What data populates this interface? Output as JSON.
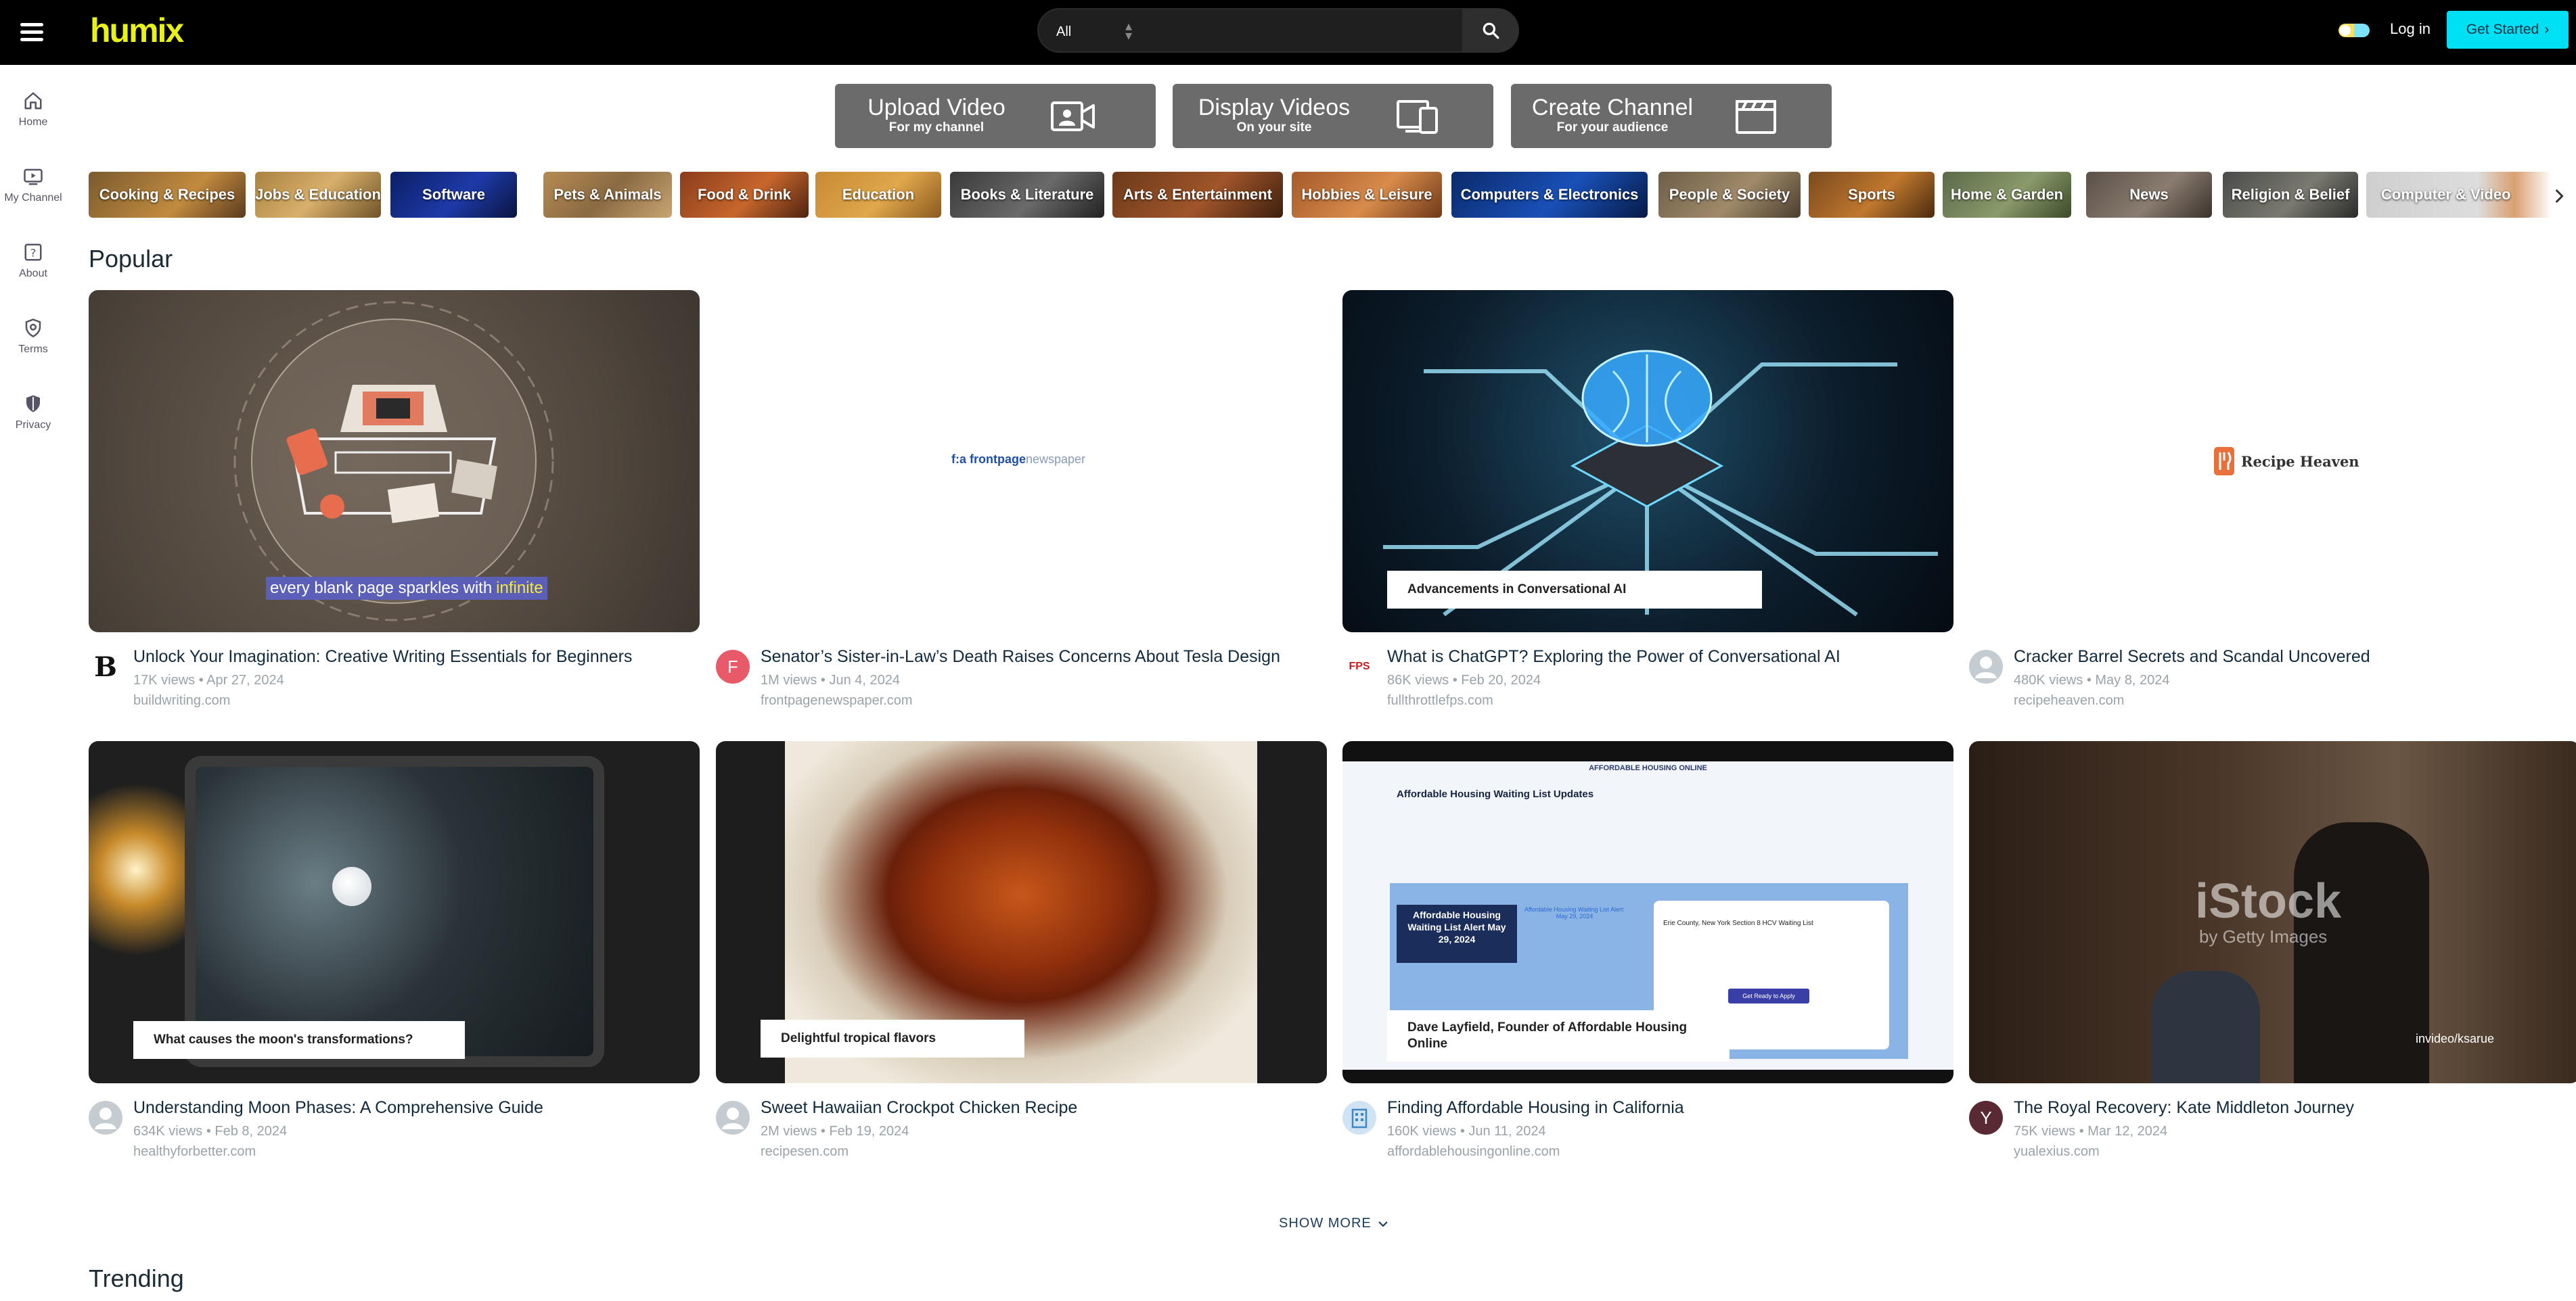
{
  "header": {
    "logo": "humix",
    "search_scope": "All",
    "search_placeholder": "",
    "login": "Log in",
    "get_started": "Get Started"
  },
  "sidebar": {
    "items": [
      {
        "label": "Home",
        "icon": "home-icon"
      },
      {
        "label": "My Channel",
        "icon": "channel-icon"
      },
      {
        "label": "About",
        "icon": "about-icon"
      },
      {
        "label": "Terms",
        "icon": "terms-icon"
      },
      {
        "label": "Privacy",
        "icon": "privacy-icon"
      }
    ]
  },
  "actions": [
    {
      "title": "Upload Video",
      "subtitle": "For my channel",
      "icon": "camera-icon"
    },
    {
      "title": "Display Videos",
      "subtitle": "On your site",
      "icon": "devices-icon"
    },
    {
      "title": "Create Channel",
      "subtitle": "For your audience",
      "icon": "clapperboard-icon"
    }
  ],
  "categories": [
    "Cooking & Recipes",
    "Jobs & Education",
    "Software",
    "Pets & Animals",
    "Food & Drink",
    "Education",
    "Books & Literature",
    "Arts & Entertainment",
    "Hobbies & Leisure",
    "Computers & Electronics",
    "People & Society",
    "Sports",
    "Home & Garden",
    "News",
    "Religion & Belief",
    "Computer & Video"
  ],
  "popular": {
    "title": "Popular",
    "videos": [
      {
        "title": "Unlock Your Imagination: Creative Writing Essentials for Beginners",
        "stats": "17K views • Apr 27, 2024",
        "domain": "buildwriting.com",
        "avatar": "B",
        "caption": "every blank page sparkles with ",
        "caption_highlight": "infinite"
      },
      {
        "title": "Senator’s Sister-in-Law’s Death Raises Concerns About Tesla Design",
        "stats": "1M views • Jun 4, 2024",
        "domain": "frontpagenewspaper.com",
        "avatar": "F",
        "brand_prefix": "f:a ",
        "brand_strong": "frontpage",
        "brand_light": "newspaper"
      },
      {
        "title": "What is ChatGPT? Exploring the Power of Conversational AI",
        "stats": "86K views • Feb 20, 2024",
        "domain": "fullthrottlefps.com",
        "avatar": "FPS",
        "caption": "Advancements in Conversational AI"
      },
      {
        "title": "Cracker Barrel Secrets and Scandal Uncovered",
        "stats": "480K views • May 8, 2024",
        "domain": "recipeheaven.com",
        "avatar": "",
        "brand": "Recipe Heaven"
      },
      {
        "title": "Understanding Moon Phases: A Comprehensive Guide",
        "stats": "634K views • Feb 8, 2024",
        "domain": "healthyforbetter.com",
        "avatar": "",
        "caption": "What causes the moon's transformations?"
      },
      {
        "title": "Sweet Hawaiian Crockpot Chicken Recipe",
        "stats": "2M views • Feb 19, 2024",
        "domain": "recipesen.com",
        "avatar": "",
        "caption": "Delightful tropical flavors"
      },
      {
        "title": "Finding Affordable Housing in California",
        "stats": "160K views • Jun 11, 2024",
        "domain": "affordablehousingonline.com",
        "avatar": "",
        "caption": "Dave Layfield, Founder of Affordable Housing Online",
        "screen": {
          "header": "AFFORDABLE HOUSING ONLINE",
          "heading": "Affordable Housing Waiting List Updates",
          "alert": "Affordable Housing Waiting List Alert May 29, 2024",
          "alert_link": "Affordable Housing Waiting List Alert: May 29, 2024",
          "list_title": "Erie County, New York Section 8 HCV Waiting List",
          "apply": "Get Ready to Apply"
        }
      },
      {
        "title": "The Royal Recovery: Kate Middleton Journey",
        "stats": "75K views • Mar 12, 2024",
        "domain": "yualexius.com",
        "avatar": "Y",
        "watermark": "iStock",
        "watermark_sub": "by Getty Images",
        "credit": "invideo/ksarue"
      }
    ]
  },
  "show_more": "SHOW MORE",
  "trending": {
    "title": "Trending"
  },
  "colors": {
    "accent": "#00e0f5",
    "logo": "#e9f218",
    "action_bg": "#6b6b6b"
  }
}
